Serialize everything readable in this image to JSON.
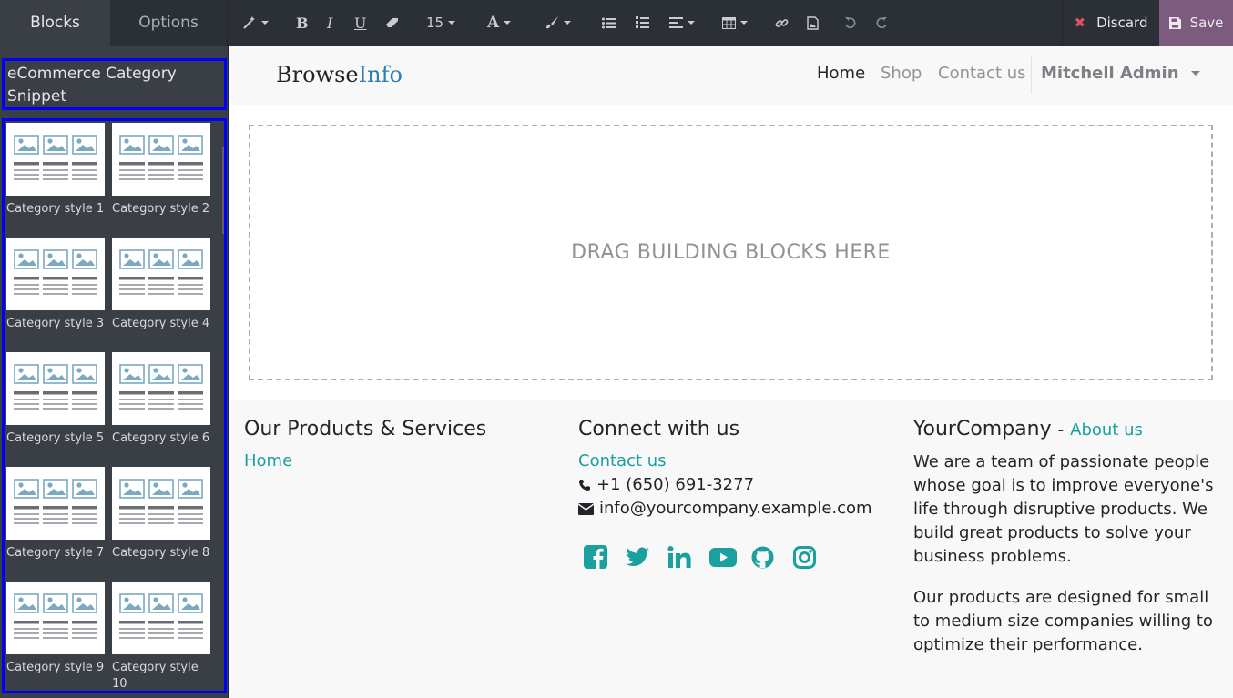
{
  "editor": {
    "tabs": [
      {
        "label": "Blocks"
      },
      {
        "label": "Options"
      }
    ],
    "font_size": "15",
    "discard_label": "Discard",
    "save_label": "Save",
    "toolbar_icons": [
      "magic-wand-icon",
      "bold-icon",
      "italic-icon",
      "underline-icon",
      "eraser-icon",
      "font-color-icon",
      "brush-icon",
      "bullet-list-icon",
      "numbered-list-icon",
      "align-icon",
      "table-icon",
      "link-icon",
      "image-icon",
      "undo-icon",
      "redo-icon"
    ],
    "colors": {
      "topbar": "#2b2f36",
      "panel": "#3a3f46",
      "save": "#7c5b7e",
      "highlight": "#0000ff"
    }
  },
  "panel": {
    "category_title": "eCommerce Category Snippet",
    "snippets": [
      {
        "label": "Category style 1"
      },
      {
        "label": "Category style 2"
      },
      {
        "label": "Category style 3"
      },
      {
        "label": "Category style 4"
      },
      {
        "label": "Category style 5"
      },
      {
        "label": "Category style 6"
      },
      {
        "label": "Category style 7"
      },
      {
        "label": "Category style 8"
      },
      {
        "label": "Category style 9"
      },
      {
        "label": "Category style 10"
      }
    ]
  },
  "site": {
    "logo_part1": "Browse",
    "logo_part2": "Info",
    "nav": {
      "home": "Home",
      "shop": "Shop",
      "contact": "Contact us",
      "user": "Mitchell Admin"
    },
    "dropzone_text": "DRAG BUILDING BLOCKS HERE",
    "footer": {
      "col1": {
        "title": "Our Products & Services",
        "links": [
          "Home"
        ]
      },
      "col2": {
        "title": "Connect with us",
        "contact_link": "Contact us",
        "phone": "+1 (650) 691-3277",
        "email": "info@yourcompany.example.com",
        "social_icons": [
          "facebook-icon",
          "twitter-icon",
          "linkedin-icon",
          "youtube-icon",
          "github-icon",
          "instagram-icon"
        ]
      },
      "col3": {
        "title": "YourCompany",
        "separator": "-",
        "about_link": "About us",
        "para1": "We are a team of passionate people whose goal is to improve everyone's life through disruptive products. We build great products to solve your business problems.",
        "para2": "Our products are designed for small to medium size companies willing to optimize their performance."
      }
    },
    "colors": {
      "accent": "#1aa09f",
      "logo_accent": "#2d7db3"
    }
  }
}
